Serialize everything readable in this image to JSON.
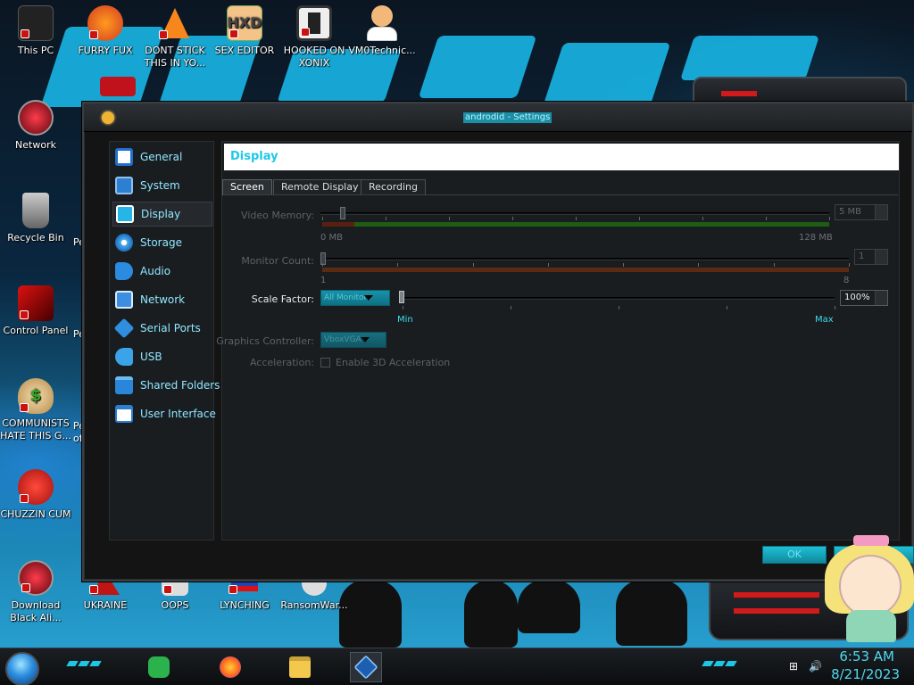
{
  "desktop": {
    "icons": [
      {
        "label": "This PC",
        "icon": "this-pc-icon"
      },
      {
        "label": "FURRY FUX",
        "icon": "firefox-icon"
      },
      {
        "label": "DONT STICK THIS IN YO...",
        "icon": "vlc-icon"
      },
      {
        "label": "SEX EDITOR",
        "icon": "hxd-editor-icon"
      },
      {
        "label": "HOOKED ON XONIX",
        "icon": "xonix-game-icon"
      },
      {
        "label": "VM0Technic...",
        "icon": "doctor-avatar-icon"
      },
      {
        "label": "Network",
        "icon": "network-icon"
      },
      {
        "label": "Recycle Bin",
        "icon": "recycle-bin-icon"
      },
      {
        "label": "Control Panel",
        "icon": "control-panel-icon"
      },
      {
        "label": "COMMUNISTS HATE THIS G...",
        "icon": "money-bag-icon"
      },
      {
        "label": "CHUZZIN CUM",
        "icon": "chuzzle-icon"
      },
      {
        "label": "Download Black Ali...",
        "icon": "alienware-icon"
      },
      {
        "label": "UKRAINE",
        "icon": "ukraine-icon"
      },
      {
        "label": "OOPS",
        "icon": "oops-icon"
      },
      {
        "label": "LYNCHING",
        "icon": "lynching-icon"
      },
      {
        "label": "RansomWar...",
        "icon": "ransomware-icon"
      }
    ],
    "partial_labels": [
      "Pe",
      "Pe",
      "Pe",
      "of"
    ]
  },
  "window": {
    "title": "androdid - Settings",
    "title_icon": "gear-icon"
  },
  "sidebar": {
    "items": [
      {
        "label": "General",
        "icon": "monitor-icon",
        "active": false
      },
      {
        "label": "System",
        "icon": "chip-icon",
        "active": false
      },
      {
        "label": "Display",
        "icon": "display-icon",
        "active": true
      },
      {
        "label": "Storage",
        "icon": "disc-icon",
        "active": false
      },
      {
        "label": "Audio",
        "icon": "speaker-icon",
        "active": false
      },
      {
        "label": "Network",
        "icon": "network-adapter-icon",
        "active": false
      },
      {
        "label": "Serial Ports",
        "icon": "serial-port-icon",
        "active": false
      },
      {
        "label": "USB",
        "icon": "usb-icon",
        "active": false
      },
      {
        "label": "Shared Folders",
        "icon": "folder-icon",
        "active": false
      },
      {
        "label": "User Interface",
        "icon": "window-icon",
        "active": false
      }
    ]
  },
  "panel": {
    "header": "Display",
    "tabs": [
      {
        "label": "Screen",
        "active": true
      },
      {
        "label": "Remote Display",
        "active": false
      },
      {
        "label": "Recording",
        "active": false
      }
    ],
    "video_memory": {
      "label": "Video Memory:",
      "min_label": "0 MB",
      "max_label": "128 MB",
      "value_text": "5 MB",
      "value": 5,
      "min": 0,
      "max": 128
    },
    "monitor_count": {
      "label": "Monitor Count:",
      "min_label": "1",
      "max_label": "8",
      "value_text": "1",
      "value": 1,
      "min": 1,
      "max": 8
    },
    "scale_factor": {
      "label": "Scale Factor:",
      "combo": "All Monitors",
      "min_label": "Min",
      "max_label": "Max",
      "value_text": "100%"
    },
    "graphics_controller": {
      "label": "Graphics Controller:",
      "value": "VboxVGA"
    },
    "acceleration": {
      "label": "Acceleration:",
      "checkbox_label": "Enable 3D Acceleration",
      "checked": false
    }
  },
  "buttons": {
    "ok": "OK"
  },
  "taskbar": {
    "apps": [
      {
        "name": "feedly-icon"
      },
      {
        "name": "firefox-icon"
      },
      {
        "name": "file-explorer-icon"
      },
      {
        "name": "virtualbox-icon",
        "active": true
      }
    ],
    "clock": {
      "time": "6:53 AM",
      "date": "8/21/2023"
    }
  },
  "colors": {
    "accent": "#1ec8e8",
    "window_bg": "#141414",
    "panel_bg": "#1a1d20"
  }
}
